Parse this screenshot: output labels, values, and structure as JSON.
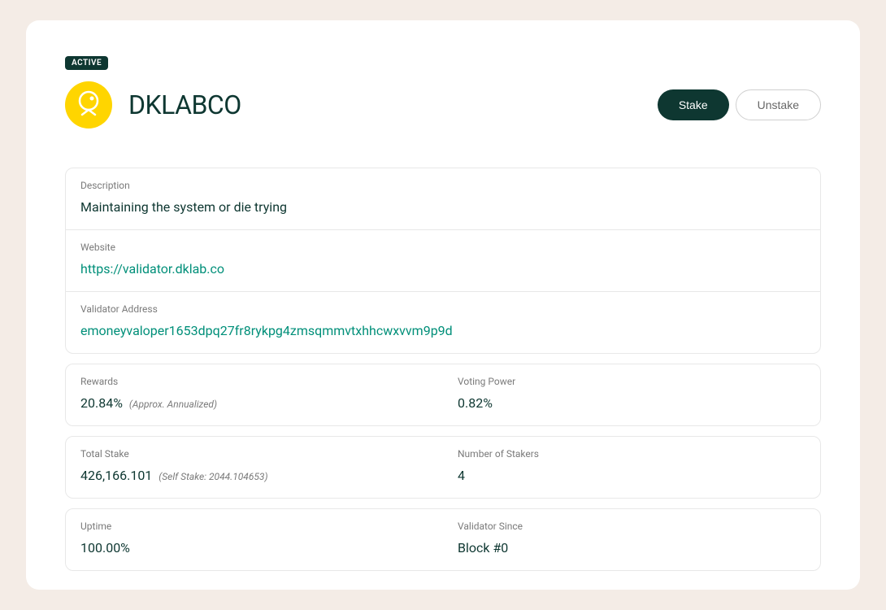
{
  "status": "ACTIVE",
  "validator": {
    "name": "DKLABCO"
  },
  "actions": {
    "stake": "Stake",
    "unstake": "Unstake"
  },
  "details": {
    "description_label": "Description",
    "description_value": "Maintaining the system or die trying",
    "website_label": "Website",
    "website_value": "https://validator.dklab.co",
    "address_label": "Validator Address",
    "address_value": "emoneyvaloper1653dpq27fr8rykpg4zmsqmmvtxhhcwxvvm9p9d"
  },
  "stats": {
    "rewards_label": "Rewards",
    "rewards_value": "20.84%",
    "rewards_note": "(Approx. Annualized)",
    "voting_power_label": "Voting Power",
    "voting_power_value": "0.82%",
    "total_stake_label": "Total Stake",
    "total_stake_value": "426,166.101",
    "total_stake_note": "(Self Stake: 2044.104653)",
    "num_stakers_label": "Number of Stakers",
    "num_stakers_value": "4",
    "uptime_label": "Uptime",
    "uptime_value": "100.00%",
    "since_label": "Validator Since",
    "since_value": "Block #0"
  }
}
